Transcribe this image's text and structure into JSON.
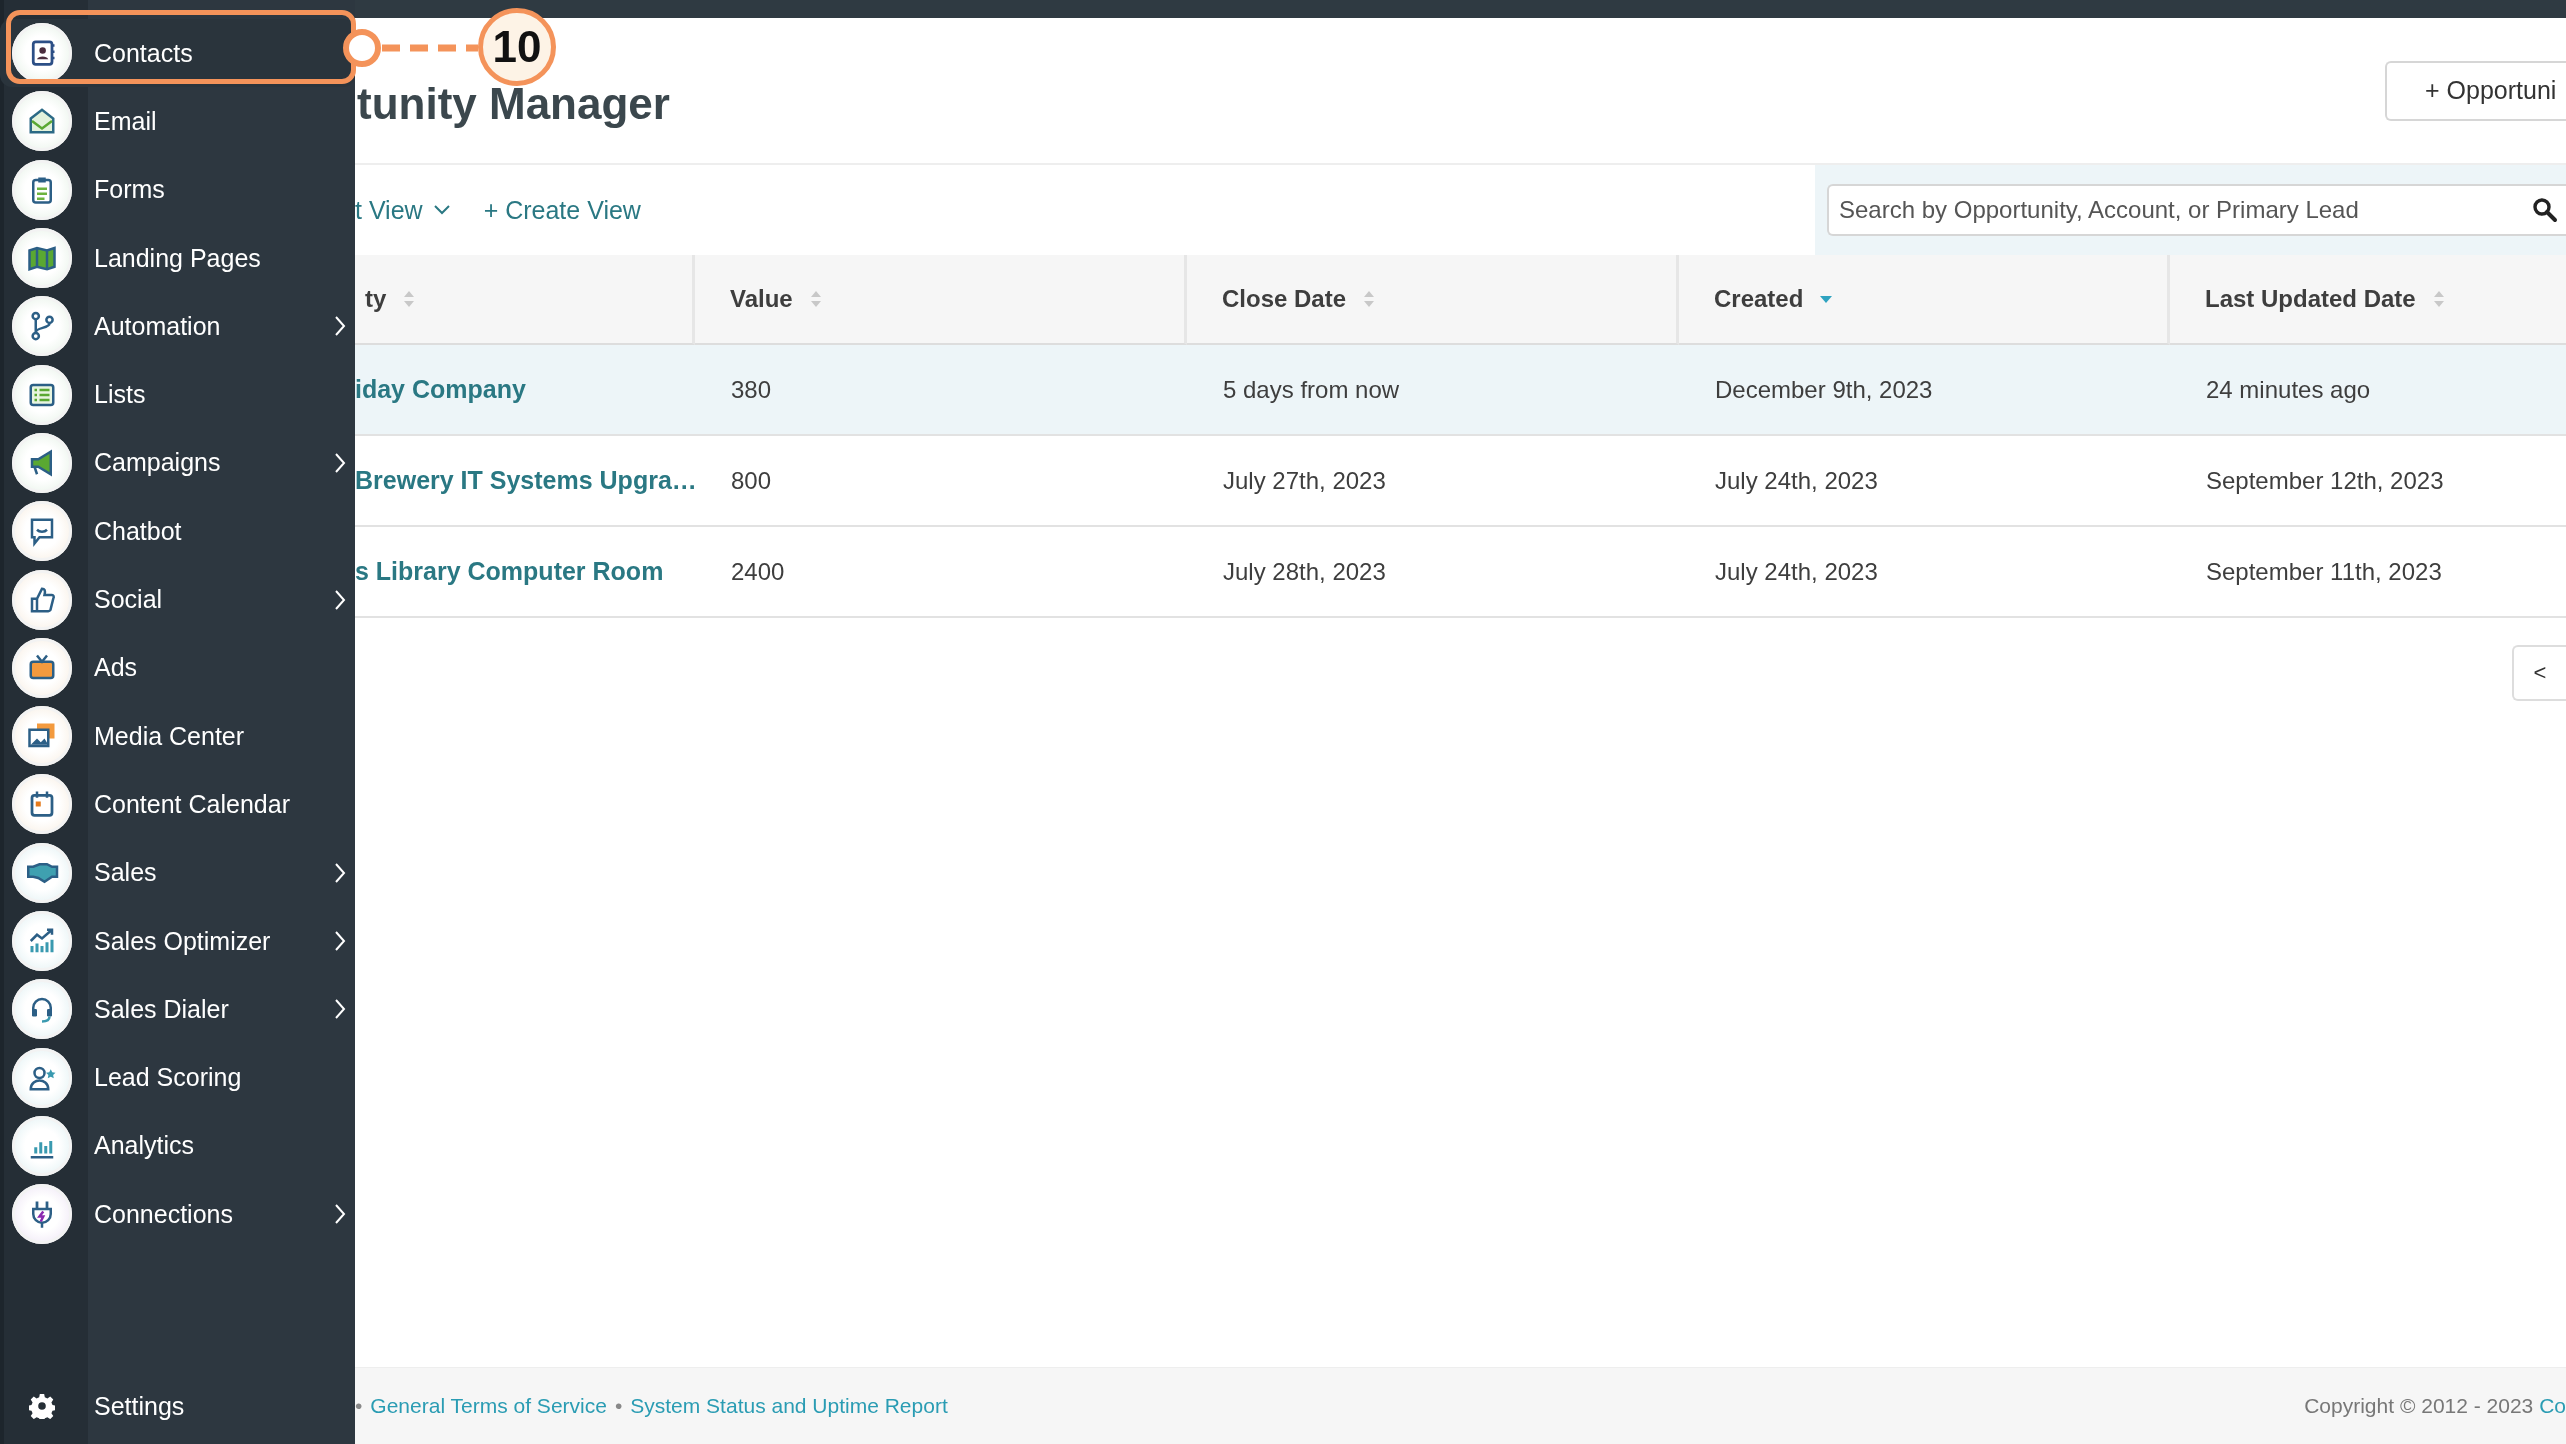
{
  "sidebar": {
    "items": [
      {
        "label": "Contacts",
        "has_submenu": false,
        "highlighted": true
      },
      {
        "label": "Email",
        "has_submenu": false,
        "highlighted": false
      },
      {
        "label": "Forms",
        "has_submenu": false,
        "highlighted": false
      },
      {
        "label": "Landing Pages",
        "has_submenu": false,
        "highlighted": false
      },
      {
        "label": "Automation",
        "has_submenu": true,
        "highlighted": false
      },
      {
        "label": "Lists",
        "has_submenu": false,
        "highlighted": false
      },
      {
        "label": "Campaigns",
        "has_submenu": true,
        "highlighted": false
      },
      {
        "label": "Chatbot",
        "has_submenu": false,
        "highlighted": false
      },
      {
        "label": "Social",
        "has_submenu": true,
        "highlighted": false
      },
      {
        "label": "Ads",
        "has_submenu": false,
        "highlighted": false
      },
      {
        "label": "Media Center",
        "has_submenu": false,
        "highlighted": false
      },
      {
        "label": "Content Calendar",
        "has_submenu": false,
        "highlighted": false
      },
      {
        "label": "Sales",
        "has_submenu": true,
        "highlighted": false
      },
      {
        "label": "Sales Optimizer",
        "has_submenu": true,
        "highlighted": false
      },
      {
        "label": "Sales Dialer",
        "has_submenu": true,
        "highlighted": false
      },
      {
        "label": "Lead Scoring",
        "has_submenu": false,
        "highlighted": false
      },
      {
        "label": "Analytics",
        "has_submenu": false,
        "highlighted": false
      },
      {
        "label": "Connections",
        "has_submenu": true,
        "highlighted": false
      }
    ],
    "settings": {
      "label": "Settings"
    }
  },
  "callout": {
    "number": "10"
  },
  "header": {
    "title": "tunity Manager",
    "add_button": "+ Opportuni"
  },
  "toolbar": {
    "view_menu": "t View",
    "create_view": "+ Create View",
    "search": {
      "placeholder": "Search by Opportunity, Account, or Primary Lead"
    }
  },
  "table": {
    "columns": [
      {
        "label": "ty",
        "sorted": false
      },
      {
        "label": "Value",
        "sorted": false
      },
      {
        "label": "Close Date",
        "sorted": false
      },
      {
        "label": "Created",
        "sorted": true
      },
      {
        "label": "Last Updated Date",
        "sorted": false
      }
    ],
    "rows": [
      {
        "selected": true,
        "cells": [
          "iday Company",
          "380",
          "5 days from now",
          "December 9th, 2023",
          "24 minutes ago"
        ]
      },
      {
        "selected": false,
        "cells": [
          "Brewery IT Systems Upgra…",
          "800",
          "July 27th, 2023",
          "July 24th, 2023",
          "September 12th, 2023"
        ]
      },
      {
        "selected": false,
        "cells": [
          "s Library Computer Room",
          "2400",
          "July 28th, 2023",
          "July 24th, 2023",
          "September 11th, 2023"
        ]
      }
    ]
  },
  "pagination": {
    "prev": "<"
  },
  "footer": {
    "links": [
      {
        "kind": "separator",
        "text": "•"
      },
      {
        "kind": "link",
        "text": "General Terms of Service"
      },
      {
        "kind": "separator",
        "text": "•"
      },
      {
        "kind": "link",
        "text": "System Status and Uptime Report"
      }
    ],
    "copyright": "Copyright © 2012 - 2023 ",
    "copyright_link": "Co"
  }
}
